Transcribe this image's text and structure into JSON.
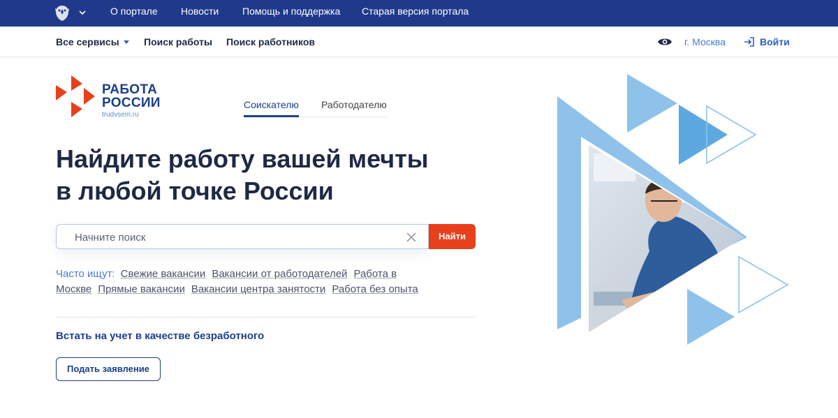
{
  "topbar": {
    "links": [
      "О портале",
      "Новости",
      "Помощь и поддержка",
      "Старая версия портала"
    ]
  },
  "nav": {
    "all_services": "Все сервисы",
    "job_search": "Поиск работы",
    "worker_search": "Поиск работников",
    "city": "г. Москва",
    "login": "Войти"
  },
  "logo": {
    "line1": "РАБОТА",
    "line2": "РОССИИ",
    "site": "trudvsem.ru"
  },
  "tabs": [
    "Соискателю",
    "Работодателю"
  ],
  "hero": {
    "title_line1": "Найдите работу вашей мечты",
    "title_line2": "в любой точке России"
  },
  "search": {
    "placeholder": "Начните поиск",
    "button": "Найти"
  },
  "frequent": {
    "label": "Часто ищут:",
    "links": [
      "Свежие вакансии",
      "Вакансии от работодателей",
      "Работа в Москве",
      "Прямые вакансии",
      "Вакансии центра занятости",
      "Работа без опыта"
    ]
  },
  "unemployment": {
    "title": "Встать на учет в качестве безработного",
    "button": "Подать заявление"
  },
  "colors": {
    "topbar": "#1f3a8a",
    "brand_blue": "#1b3f8a",
    "accent_red": "#e8401c",
    "link_blue": "#4b7bd0"
  }
}
